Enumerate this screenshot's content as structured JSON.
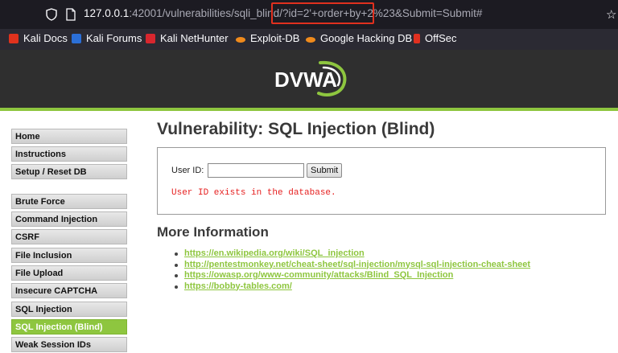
{
  "browser": {
    "url_prefix_dim_host": "127.0.0.1",
    "url_port": ":42001",
    "url_path_before": "/vulnerabilities/sqli_blind/",
    "url_query": "?id=2'+order+by+2%23&Submit=Submit#",
    "url_query_part1": "?id=2'+order+by+2",
    "url_query_part2": "%23&Submit=Submit#",
    "bookmarks": [
      {
        "label": "Kali Docs",
        "icon": "kali-docs-icon",
        "color": "#e0321d"
      },
      {
        "label": "Kali Forums",
        "icon": "kali-forums-icon",
        "color": "#2b6fd8"
      },
      {
        "label": "Kali NetHunter",
        "icon": "kali-nethunter-icon",
        "color": "#d8262e"
      },
      {
        "label": "Exploit-DB",
        "icon": "exploit-db-icon",
        "color": "#f08a1c"
      },
      {
        "label": "Google Hacking DB",
        "icon": "google-hacking-db-icon",
        "color": "#f08a1c"
      },
      {
        "label": "OffSec",
        "icon": "offsec-icon",
        "color": "#e03020"
      }
    ]
  },
  "header": {
    "logo_text": "DVWA"
  },
  "sidebar": {
    "items": [
      {
        "label": "Home",
        "active": false
      },
      {
        "label": "Instructions",
        "active": false
      },
      {
        "label": "Setup / Reset DB",
        "active": false
      },
      {
        "label": "Brute Force",
        "active": false
      },
      {
        "label": "Command Injection",
        "active": false
      },
      {
        "label": "CSRF",
        "active": false
      },
      {
        "label": "File Inclusion",
        "active": false
      },
      {
        "label": "File Upload",
        "active": false
      },
      {
        "label": "Insecure CAPTCHA",
        "active": false
      },
      {
        "label": "SQL Injection",
        "active": false
      },
      {
        "label": "SQL Injection (Blind)",
        "active": true
      },
      {
        "label": "Weak Session IDs",
        "active": false
      }
    ]
  },
  "main": {
    "title": "Vulnerability: SQL Injection (Blind)",
    "form": {
      "label": "User ID:",
      "input_value": "",
      "submit_label": "Submit"
    },
    "result_message": "User ID exists in the database.",
    "more_title": "More Information",
    "links": [
      "https://en.wikipedia.org/wiki/SQL_injection",
      "http://pentestmonkey.net/cheat-sheet/sql-injection/mysql-sql-injection-cheat-sheet",
      "https://owasp.org/www-community/attacks/Blind_SQL_Injection",
      "https://bobby-tables.com/"
    ]
  },
  "colors": {
    "accent_green": "#8ec63f",
    "error_red": "#e62020",
    "highlight_box": "#e0301e"
  }
}
